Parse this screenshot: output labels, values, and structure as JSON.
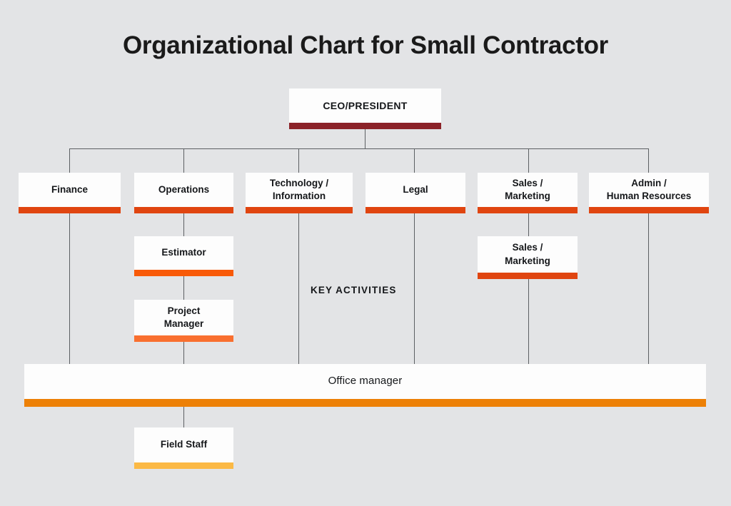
{
  "title": "Organizational Chart for Small Contractor",
  "background_color": "#e3e4e6",
  "connector_color": "#5c6063",
  "caption": {
    "key_activities": "KEY ACTIVITIES"
  },
  "colors": {
    "ceo_accent": "#8b2228",
    "level2_accent": "#e04510",
    "estimator_accent": "#f85a08",
    "project_manager_accent": "#f96f2f",
    "office_manager_accent": "#ed8006",
    "field_staff_accent": "#fbb945",
    "node_fill": "#fdfdfd",
    "text": "#15171a"
  },
  "nodes": {
    "ceo": {
      "label": "CEO/PRESIDENT",
      "accent": "#8b2228"
    },
    "level2": [
      {
        "label": "Finance",
        "accent": "#e04510"
      },
      {
        "label": "Operations",
        "accent": "#e04510"
      },
      {
        "label": "Technology /\nInformation",
        "accent": "#e04510"
      },
      {
        "label": "Legal",
        "accent": "#e04510"
      },
      {
        "label": "Sales /\nMarketing",
        "accent": "#e04510"
      },
      {
        "label": "Admin /\nHuman Resources",
        "accent": "#e04510"
      }
    ],
    "estimator": {
      "label": "Estimator",
      "accent": "#f85a08"
    },
    "project_manager": {
      "label": "Project\nManager",
      "accent": "#f96f2f"
    },
    "sales_marketing_sub": {
      "label": "Sales /\nMarketing",
      "accent": "#e04510"
    },
    "office_manager": {
      "label": "Office manager",
      "accent": "#ed8006"
    },
    "field_staff": {
      "label": "Field Staff",
      "accent": "#fbb945"
    }
  },
  "chart_data": {
    "type": "diagram",
    "diagram_type": "organizational-chart",
    "title": "Organizational Chart for Small Contractor",
    "levels": [
      {
        "level": 1,
        "nodes": [
          "CEO/PRESIDENT"
        ]
      },
      {
        "level": 2,
        "nodes": [
          "Finance",
          "Operations",
          "Technology / Information",
          "Legal",
          "Sales / Marketing",
          "Admin / Human Resources"
        ]
      },
      {
        "level": 3,
        "nodes": [
          "Estimator",
          "Sales / Marketing"
        ]
      },
      {
        "level": 4,
        "nodes": [
          "Project Manager"
        ]
      },
      {
        "level": 5,
        "nodes": [
          "Office manager"
        ]
      },
      {
        "level": 6,
        "nodes": [
          "Field Staff"
        ]
      }
    ],
    "edges": [
      {
        "from": "CEO/PRESIDENT",
        "to": "Finance"
      },
      {
        "from": "CEO/PRESIDENT",
        "to": "Operations"
      },
      {
        "from": "CEO/PRESIDENT",
        "to": "Technology / Information"
      },
      {
        "from": "CEO/PRESIDENT",
        "to": "Legal"
      },
      {
        "from": "CEO/PRESIDENT",
        "to": "Sales / Marketing"
      },
      {
        "from": "CEO/PRESIDENT",
        "to": "Admin / Human Resources"
      },
      {
        "from": "Operations",
        "to": "Estimator"
      },
      {
        "from": "Estimator",
        "to": "Project Manager"
      },
      {
        "from": "Sales / Marketing",
        "to": "Sales / Marketing (sub)"
      },
      {
        "from": "Project Manager",
        "to": "Office manager"
      },
      {
        "from": "Office manager",
        "to": "Field Staff"
      }
    ],
    "annotations": [
      "KEY ACTIVITIES"
    ]
  }
}
